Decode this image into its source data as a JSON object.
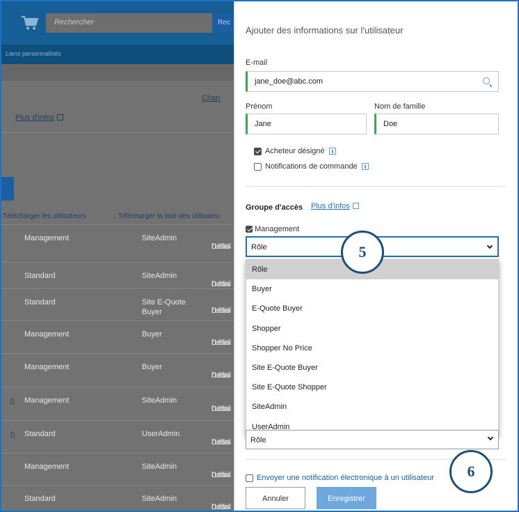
{
  "background": {
    "search_placeholder": "Rechercher",
    "search_button": "Rec",
    "links_bar": "Liens personnalisés",
    "change_link": "Chan",
    "more_info_link": "Plus d'infos",
    "download_users": "Télécharger les utilisateurs",
    "download_user_list": "↓ Télécharger la liste des utilisateu",
    "rows": [
      {
        "prefix": "",
        "type": "Management",
        "role": "SiteAdmin",
        "link1": "Détail",
        "link2": "l'utilis"
      },
      {
        "prefix": "",
        "type": "Standard",
        "role": "SiteAdmin",
        "link1": "Détail",
        "link2": "l'utilis"
      },
      {
        "prefix": "",
        "type": "Standard",
        "role": "Site E-Quote Buyer",
        "link1": "Détail",
        "link2": "l'utilis"
      },
      {
        "prefix": "",
        "type": "Management",
        "role": "Buyer",
        "link1": "Détail",
        "link2": "l'utilis"
      },
      {
        "prefix": "",
        "type": "Management",
        "role": "Buyer",
        "link1": "Détail",
        "link2": "l'utilis"
      },
      {
        "prefix": "n",
        "type": "Management",
        "role": "SiteAdmin",
        "link1": "Détail",
        "link2": "l'utilis"
      },
      {
        "prefix": "n",
        "type": "Standard",
        "role": "UserAdmin",
        "link1": "Détail",
        "link2": "l'utilis"
      },
      {
        "prefix": "",
        "type": "Management",
        "role": "SiteAdmin",
        "link1": "Détail",
        "link2": "l'utilis"
      },
      {
        "prefix": "",
        "type": "Standard",
        "role": "SiteAdmin",
        "link1": "Détail",
        "link2": "l'utilis"
      }
    ]
  },
  "panel": {
    "title": "Ajouter des informations sur l'utilisateur",
    "email_label": "E-mail",
    "email_value": "jane_doe@abc.com",
    "first_name_label": "Prénom",
    "first_name_value": "Jane",
    "last_name_label": "Nom de famille",
    "last_name_value": "Doe",
    "designated_buyer": "Acheteur désigné",
    "order_notifications": "Notifications de commande",
    "access_group_label": "Groupe d'accès",
    "access_more_info": "Plus d'infos",
    "management_label": "Management",
    "role_select_value": "Rôle",
    "role_options": [
      "Rôle",
      "Buyer",
      "E-Quote Buyer",
      "Shopper",
      "Shopper No Price",
      "Site E-Quote Buyer",
      "Site E-Quote Shopper",
      "SiteAdmin",
      "UserAdmin"
    ],
    "second_role_select_value": "Rôle",
    "send_notification": "Envoyer une notification électronique à un utilisateur",
    "cancel_button": "Annuler",
    "save_button": "Enregistrer"
  },
  "callouts": {
    "first": "5",
    "second": "6"
  },
  "colors": {
    "accent": "#1a72c4",
    "valid_border": "#3ba84b",
    "save_button": "#6fa8dc",
    "callout": "#1d4f7d"
  }
}
